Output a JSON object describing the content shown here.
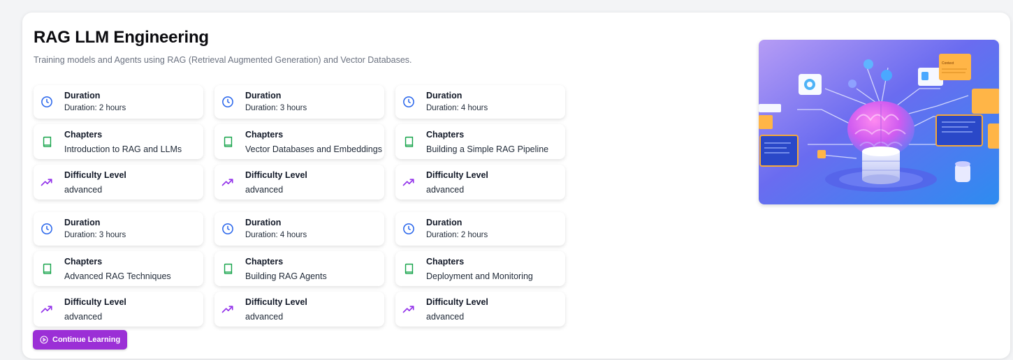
{
  "course": {
    "title": "RAG LLM Engineering",
    "subtitle": "Training models and Agents using RAG (Retrieval Augmented Generation) and Vector Databases.",
    "continue_label": "Continue Learning"
  },
  "labels": {
    "duration": "Duration",
    "chapters": "Chapters",
    "difficulty": "Difficulty Level"
  },
  "colors": {
    "clock_icon": "#2563eb",
    "book_icon": "#16a34a",
    "trend_icon": "#9333ea",
    "button": "#9b2fd6"
  },
  "modules": [
    [
      {
        "duration": "Duration: 2 hours",
        "chapter": "Introduction to RAG and LLMs",
        "difficulty": "advanced"
      },
      {
        "duration": "Duration: 3 hours",
        "chapter": "Vector Databases and Embeddings",
        "difficulty": "advanced"
      },
      {
        "duration": "Duration: 4 hours",
        "chapter": "Building a Simple RAG Pipeline",
        "difficulty": "advanced"
      }
    ],
    [
      {
        "duration": "Duration: 3 hours",
        "chapter": "Advanced RAG Techniques",
        "difficulty": "advanced"
      },
      {
        "duration": "Duration: 4 hours",
        "chapter": "Building RAG Agents",
        "difficulty": "advanced"
      },
      {
        "duration": "Duration: 2 hours",
        "chapter": "Deployment and Monitoring",
        "difficulty": "advanced"
      }
    ]
  ],
  "hero": {
    "note_label": "Context"
  }
}
